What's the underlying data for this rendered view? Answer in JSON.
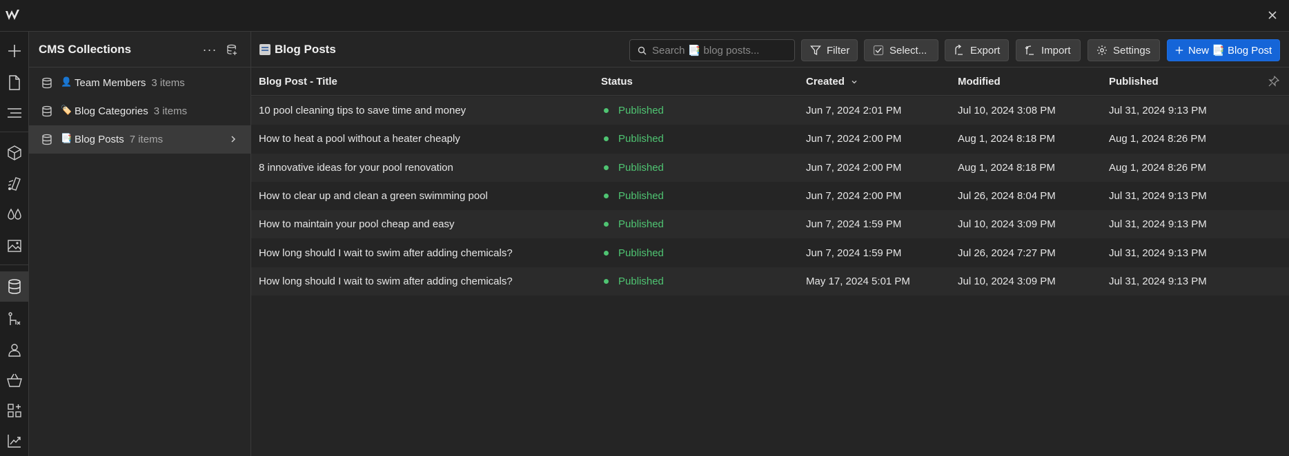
{
  "colors": {
    "accent": "#1565d8",
    "published": "#4fc472",
    "background": "#252525"
  },
  "sidebar": {
    "title": "CMS Collections",
    "more_label": "···",
    "items": [
      {
        "emoji": "👤",
        "name": "Team Members",
        "count": "3 items",
        "icon": "database-icon"
      },
      {
        "emoji": "🏷️",
        "name": "Blog Categories",
        "count": "3 items",
        "icon": "database-icon"
      },
      {
        "emoji": "📑",
        "name": "Blog Posts",
        "count": "7 items",
        "icon": "database-icon",
        "active": true
      }
    ]
  },
  "main": {
    "title": "Blog Posts",
    "search": {
      "placeholder": "Search 📑 blog posts..."
    },
    "toolbar": {
      "filter": "Filter",
      "select": "Select...",
      "export": "Export",
      "import": "Import",
      "settings": "Settings",
      "new": "New 📑 Blog Post"
    },
    "columns": {
      "title": "Blog Post - Title",
      "status": "Status",
      "created": "Created",
      "modified": "Modified",
      "published": "Published"
    },
    "rows": [
      {
        "title": "10 pool cleaning tips to save time and money",
        "status": "Published",
        "created": "Jun 7, 2024 2:01 PM",
        "modified": "Jul 10, 2024 3:08 PM",
        "published": "Jul 31, 2024 9:13 PM"
      },
      {
        "title": "How to heat a pool without a heater cheaply",
        "status": "Published",
        "created": "Jun 7, 2024 2:00 PM",
        "modified": "Aug 1, 2024 8:18 PM",
        "published": "Aug 1, 2024 8:26 PM"
      },
      {
        "title": "8 innovative ideas for your pool renovation",
        "status": "Published",
        "created": "Jun 7, 2024 2:00 PM",
        "modified": "Aug 1, 2024 8:18 PM",
        "published": "Aug 1, 2024 8:26 PM"
      },
      {
        "title": "How to clear up and clean a green swimming pool",
        "status": "Published",
        "created": "Jun 7, 2024 2:00 PM",
        "modified": "Jul 26, 2024 8:04 PM",
        "published": "Jul 31, 2024 9:13 PM"
      },
      {
        "title": "How to maintain your pool cheap and easy",
        "status": "Published",
        "created": "Jun 7, 2024 1:59 PM",
        "modified": "Jul 10, 2024 3:09 PM",
        "published": "Jul 31, 2024 9:13 PM"
      },
      {
        "title": "How long should I wait to swim after adding chemicals?",
        "status": "Published",
        "created": "Jun 7, 2024 1:59 PM",
        "modified": "Jul 26, 2024 7:27 PM",
        "published": "Jul 31, 2024 9:13 PM"
      },
      {
        "title": "How long should I wait to swim after adding chemicals?",
        "status": "Published",
        "created": "May 17, 2024 5:01 PM",
        "modified": "Jul 10, 2024 3:09 PM",
        "published": "Jul 31, 2024 9:13 PM"
      }
    ]
  },
  "rail_icons": [
    "add-icon",
    "page-icon",
    "navigator-icon",
    "components-icon",
    "style-icon",
    "variables-icon",
    "assets-icon",
    "cms-icon",
    "logic-icon",
    "users-icon",
    "ecommerce-icon",
    "apps-icon",
    "analytics-icon"
  ]
}
